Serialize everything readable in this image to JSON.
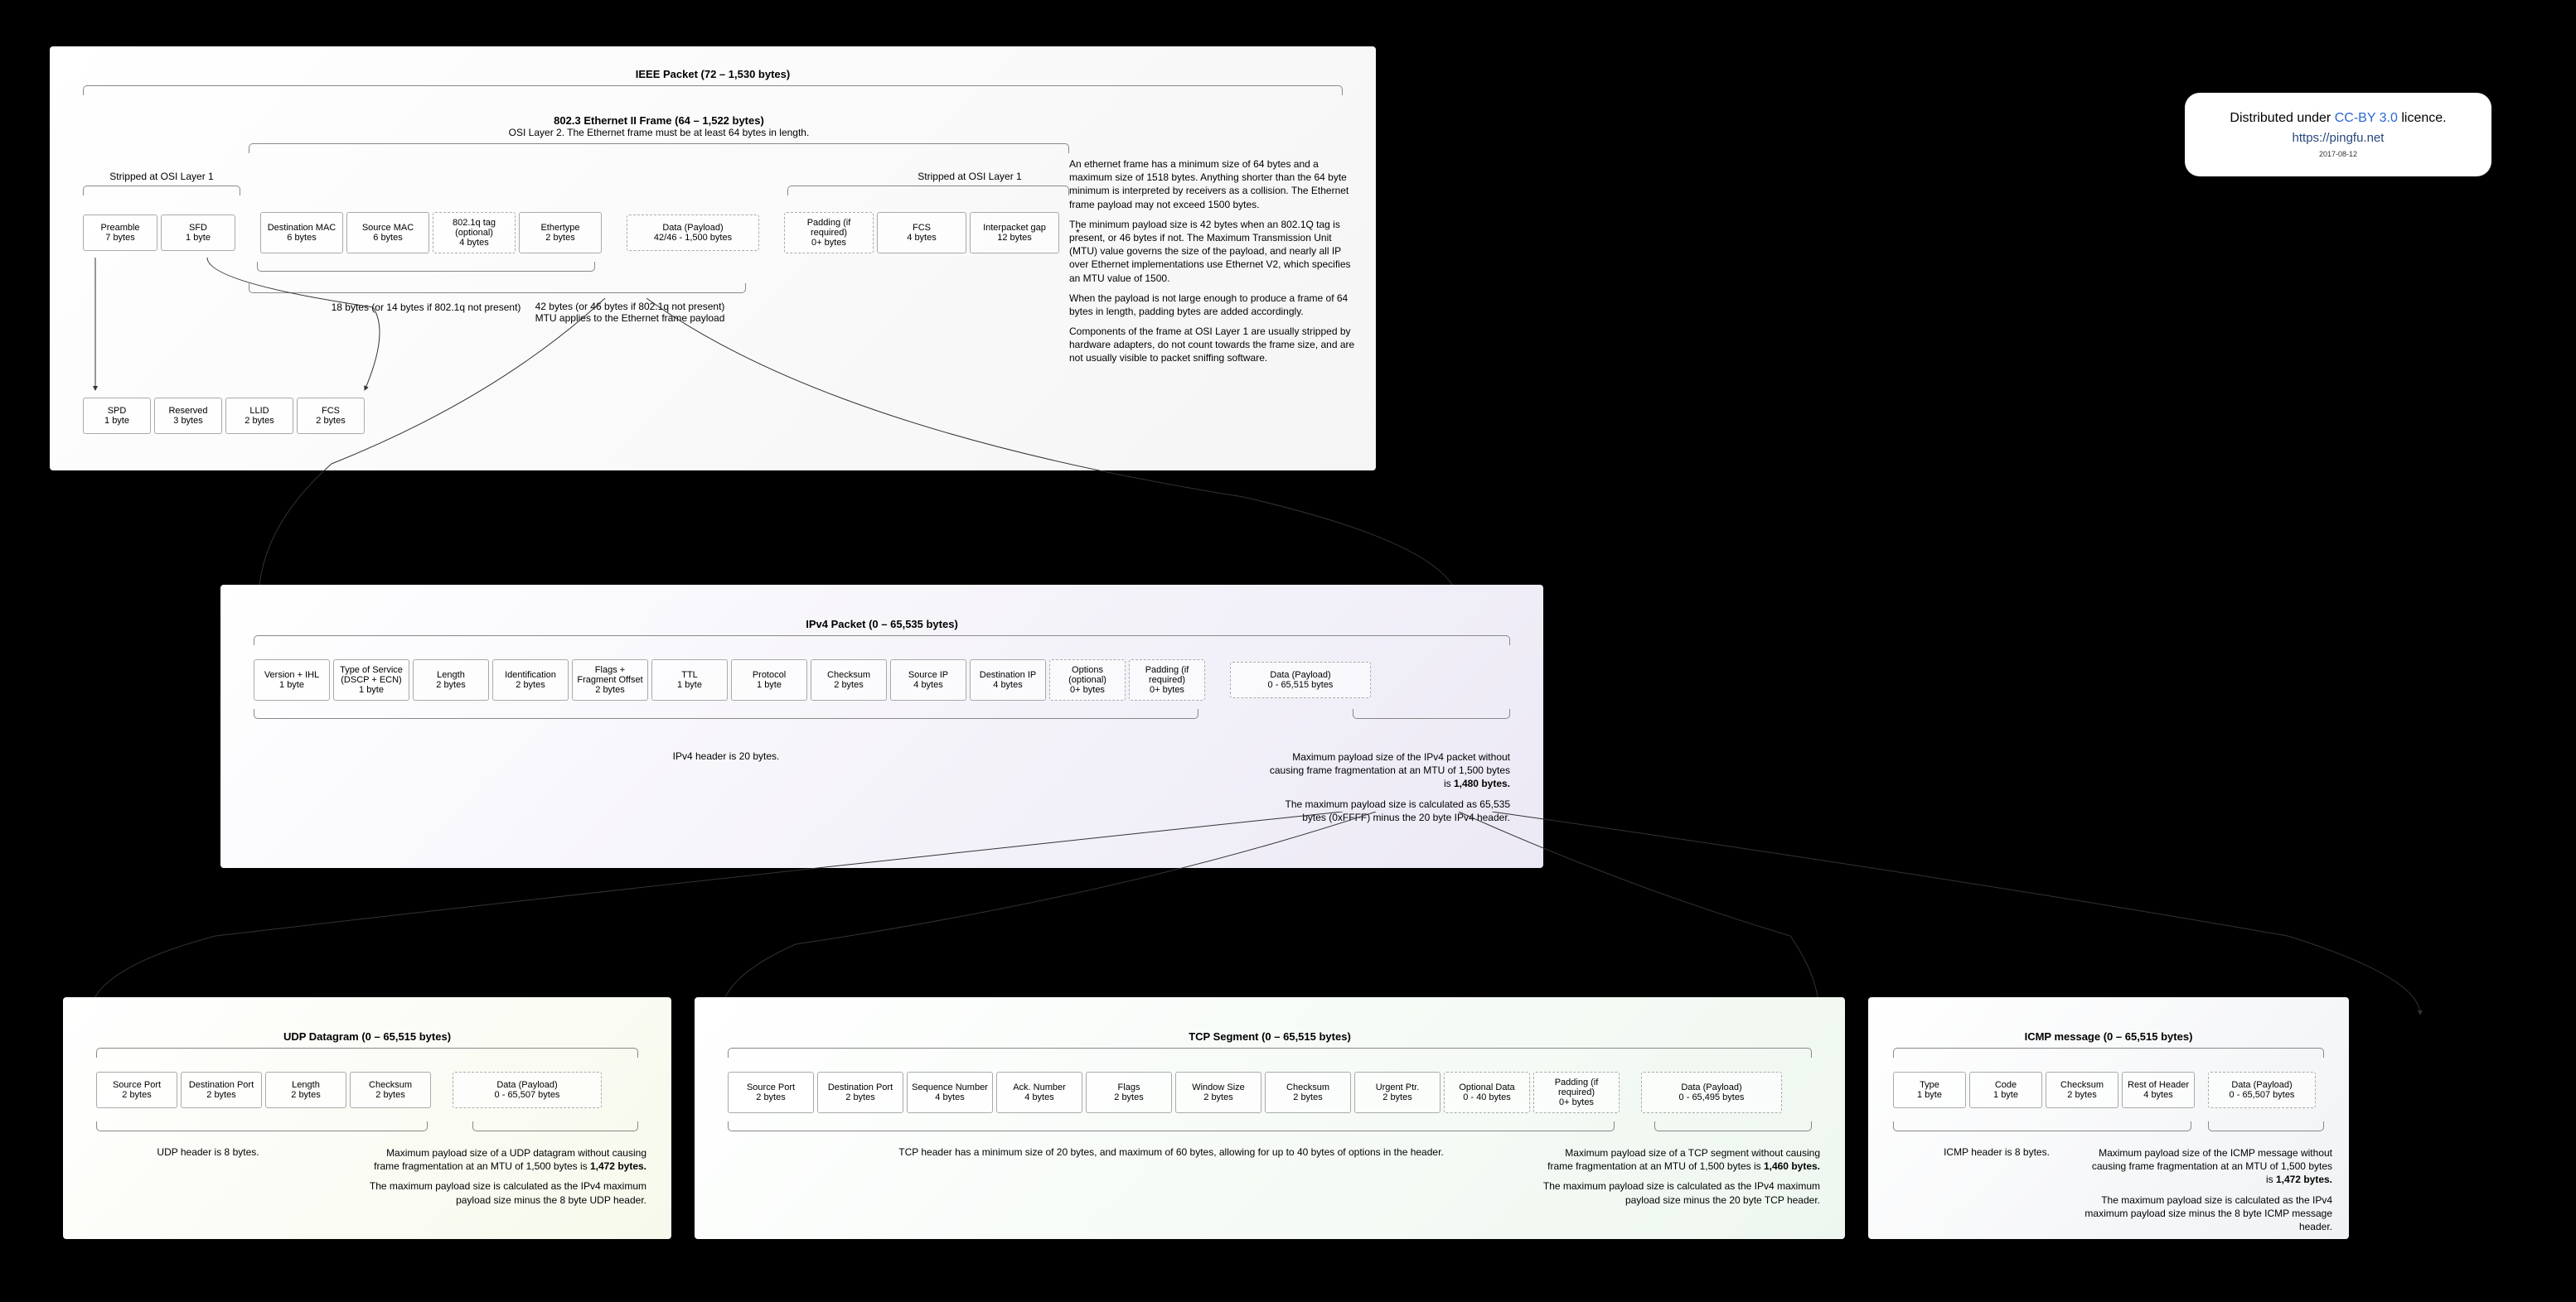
{
  "licence": {
    "prefix": "Distributed under ",
    "link_text": "CC-BY 3.0",
    "suffix": " licence.",
    "site": "https://pingfu.net",
    "date": "2017-08-12"
  },
  "ieee": {
    "title": "IEEE Packet (72 – 1,530 bytes)",
    "frame_title": "802.3 Ethernet II Frame (64 – 1,522 bytes)",
    "frame_subtitle": "OSI Layer 2. The Ethernet frame must be at least 64 bytes in length.",
    "stripped_left": "Stripped at OSI Layer 1",
    "stripped_right": "Stripped at OSI Layer 1",
    "fields_l1_left": [
      {
        "name": "Preamble",
        "size": "7 bytes"
      },
      {
        "name": "SFD",
        "size": "1 byte"
      }
    ],
    "fields_eth": [
      {
        "name": "Destination MAC",
        "size": "6 bytes"
      },
      {
        "name": "Source MAC",
        "size": "6 bytes"
      },
      {
        "name": "802.1q tag\n(optional)",
        "size": "4 bytes",
        "dashed": true
      },
      {
        "name": "Ethertype",
        "size": "2 bytes"
      }
    ],
    "payload": {
      "name": "Data (Payload)",
      "size": "42/46 - 1,500 bytes"
    },
    "fields_l1_right": [
      {
        "name": "Padding (if required)",
        "size": "0+ bytes",
        "dashed": true
      },
      {
        "name": "FCS",
        "size": "4 bytes"
      },
      {
        "name": "Interpacket gap",
        "size": "12 bytes"
      }
    ],
    "note_18": "18 bytes (or 14 bytes if 802.1q not present)",
    "note_42a": "42 bytes (or 46 bytes if 802.1q not present)",
    "note_42b": "MTU applies to the Ethernet frame payload",
    "asterisk": "*",
    "epon": [
      {
        "name": "SPD",
        "size": "1 byte"
      },
      {
        "name": "Reserved",
        "size": "3 bytes"
      },
      {
        "name": "LLID",
        "size": "2 bytes"
      },
      {
        "name": "FCS",
        "size": "2 bytes"
      }
    ],
    "paras": [
      "An ethernet frame has a minimum size of 64 bytes and a maximum size of 1518 bytes. Anything shorter than the 64 byte minimum is interpreted by receivers as a collision. The Ethernet frame payload may not exceed 1500 bytes.",
      "The minimum payload size is 42 bytes when an 802.1Q tag is present, or 46 bytes if not. The Maximum Transmission Unit (MTU) value governs the size of the payload, and nearly all IP over Ethernet implementations use Ethernet V2, which specifies an MTU value of 1500.",
      "When the payload is not large enough to produce a frame of 64 bytes in length, padding bytes are added accordingly.",
      "Components of the frame at OSI Layer 1 are usually stripped by hardware adapters, do not count towards the frame size, and are not usually visible to packet sniffing software."
    ]
  },
  "ipv4": {
    "title": "IPv4 Packet (0 – 65,535 bytes)",
    "fields": [
      {
        "name": "Version + IHL",
        "size": "1 byte"
      },
      {
        "name": "Type of Service\n(DSCP + ECN)",
        "size": "1 byte"
      },
      {
        "name": "Length",
        "size": "2 bytes"
      },
      {
        "name": "Identification",
        "size": "2 bytes"
      },
      {
        "name": "Flags + Fragment Offset",
        "size": "2 bytes"
      },
      {
        "name": "TTL",
        "size": "1 byte"
      },
      {
        "name": "Protocol",
        "size": "1 byte"
      },
      {
        "name": "Checksum",
        "size": "2 bytes"
      },
      {
        "name": "Source IP",
        "size": "4 bytes"
      },
      {
        "name": "Destination IP",
        "size": "4 bytes"
      },
      {
        "name": "Options (optional)",
        "size": "0+ bytes",
        "dashed": true
      },
      {
        "name": "Padding (if required)",
        "size": "0+ bytes",
        "dashed": true
      }
    ],
    "payload": {
      "name": "Data (Payload)",
      "size": "0 - 65,515 bytes"
    },
    "header_note": "IPv4 header is 20 bytes.",
    "max_note_1a": "Maximum payload size of the IPv4 packet without causing frame fragmentation at an MTU of 1,500 bytes is ",
    "max_note_1b": "1,480 bytes.",
    "max_note_2": "The maximum payload size is calculated as 65,535 bytes (0xFFFF) minus the 20 byte IPv4 header."
  },
  "udp": {
    "title": "UDP Datagram (0 – 65,515 bytes)",
    "fields": [
      {
        "name": "Source Port",
        "size": "2 bytes"
      },
      {
        "name": "Destination Port",
        "size": "2 bytes"
      },
      {
        "name": "Length",
        "size": "2 bytes"
      },
      {
        "name": "Checksum",
        "size": "2 bytes"
      }
    ],
    "payload": {
      "name": "Data (Payload)",
      "size": "0 - 65,507 bytes"
    },
    "header_note": "UDP header is 8 bytes.",
    "max_note_1a": "Maximum payload size of a UDP datagram without causing frame fragmentation at an MTU of 1,500 bytes is ",
    "max_note_1b": "1,472 bytes.",
    "max_note_2": "The maximum payload size is calculated as the IPv4 maximum payload size minus the 8 byte UDP header."
  },
  "tcp": {
    "title": "TCP Segment (0 – 65,515 bytes)",
    "fields": [
      {
        "name": "Source Port",
        "size": "2 bytes"
      },
      {
        "name": "Destination Port",
        "size": "2 bytes"
      },
      {
        "name": "Sequence Number",
        "size": "4 bytes"
      },
      {
        "name": "Ack. Number",
        "size": "4 bytes"
      },
      {
        "name": "Flags",
        "size": "2 bytes"
      },
      {
        "name": "Window Size",
        "size": "2 bytes"
      },
      {
        "name": "Checksum",
        "size": "2 bytes"
      },
      {
        "name": "Urgent Ptr.",
        "size": "2 bytes"
      },
      {
        "name": "Optional Data",
        "size": "0 - 40 bytes",
        "dashed": true
      },
      {
        "name": "Padding (if required)",
        "size": "0+ bytes",
        "dashed": true
      }
    ],
    "payload": {
      "name": "Data (Payload)",
      "size": "0 - 65,495 bytes"
    },
    "header_note": "TCP header has a minimum size of 20 bytes, and maximum of 60 bytes, allowing for up to 40 bytes of options in the header.",
    "max_note_1a": "Maximum payload size of a TCP segment without causing frame fragmentation at an MTU of 1,500 bytes is ",
    "max_note_1b": "1,460 bytes.",
    "max_note_2": "The maximum payload size is calculated as the IPv4 maximum payload size minus the 20 byte TCP header."
  },
  "icmp": {
    "title": "ICMP message (0 – 65,515 bytes)",
    "fields": [
      {
        "name": "Type",
        "size": "1 byte"
      },
      {
        "name": "Code",
        "size": "1 byte"
      },
      {
        "name": "Checksum",
        "size": "2 bytes"
      },
      {
        "name": "Rest of Header",
        "size": "4 bytes"
      }
    ],
    "payload": {
      "name": "Data (Payload)",
      "size": "0 - 65,507 bytes"
    },
    "header_note": "ICMP header is 8 bytes.",
    "max_note_1a": "Maximum payload size of the ICMP message without causing frame fragmentation at an MTU of 1,500 bytes is ",
    "max_note_1b": "1,472 bytes.",
    "max_note_2": "The maximum payload size is calculated as the IPv4 maximum payload size minus the 8 byte ICMP message header."
  }
}
